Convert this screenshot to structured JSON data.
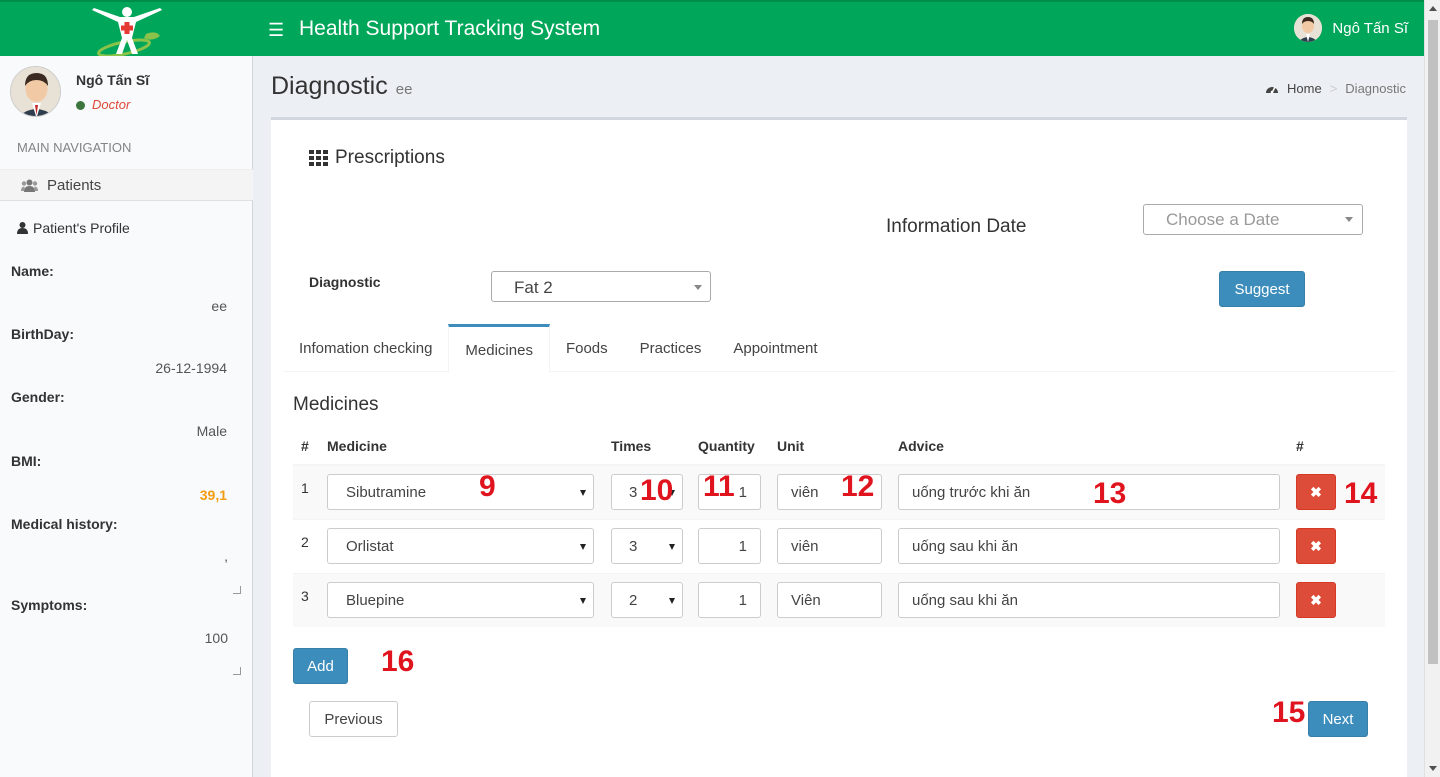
{
  "header": {
    "app_title": "Health Support Tracking System",
    "user_name": "Ngô Tấn Sĩ"
  },
  "sidebar": {
    "user_name": "Ngô Tấn Sĩ",
    "user_role": "Doctor",
    "nav_header": "MAIN NAVIGATION",
    "nav_items": [
      {
        "label": "Patients",
        "icon": "users-icon"
      }
    ],
    "profile_header": "Patient's Profile",
    "fields": {
      "name_label": "Name:",
      "name_value": "ee",
      "birthday_label": "BirthDay:",
      "birthday_value": "26-12-1994",
      "gender_label": "Gender:",
      "gender_value": "Male",
      "bmi_label": "BMI:",
      "bmi_value": "39,1",
      "history_label": "Medical history:",
      "history_value": ",",
      "symptoms_label": "Symptoms:",
      "symptoms_value": "100"
    }
  },
  "page": {
    "title": "Diagnostic",
    "subtitle": "ee",
    "breadcrumb": {
      "home": "Home",
      "current": "Diagnostic"
    }
  },
  "box": {
    "title": "Prescriptions",
    "info_date_label": "Information Date",
    "date_placeholder": "Choose a Date",
    "diagnostic_label": "Diagnostic",
    "diagnostic_value": "Fat 2",
    "suggest_label": "Suggest",
    "tabs": [
      {
        "label": "Infomation checking",
        "active": false
      },
      {
        "label": "Medicines",
        "active": true
      },
      {
        "label": "Foods",
        "active": false
      },
      {
        "label": "Practices",
        "active": false
      },
      {
        "label": "Appointment",
        "active": false
      }
    ],
    "section_title": "Medicines",
    "columns": [
      "#",
      "Medicine",
      "Times",
      "Quantity",
      "Unit",
      "Advice",
      "#"
    ],
    "rows": [
      {
        "num": "1",
        "medicine": "Sibutramine",
        "times": "3",
        "quantity": "1",
        "unit": "viên",
        "advice": "uống trước khi ăn"
      },
      {
        "num": "2",
        "medicine": "Orlistat",
        "times": "3",
        "quantity": "1",
        "unit": "viên",
        "advice": "uống sau khi ăn"
      },
      {
        "num": "3",
        "medicine": "Bluepine",
        "times": "2",
        "quantity": "1",
        "unit": "Viên",
        "advice": "uống sau khi ăn"
      }
    ],
    "add_label": "Add",
    "previous_label": "Previous",
    "next_label": "Next"
  },
  "annotations": [
    "9",
    "10",
    "11",
    "12",
    "13",
    "14",
    "15",
    "16"
  ],
  "colors": {
    "header": "#00a65a",
    "primary": "#3c8dbc",
    "danger": "#dd4b39",
    "bmi": "#f39c12",
    "annotation": "#e0141e"
  }
}
